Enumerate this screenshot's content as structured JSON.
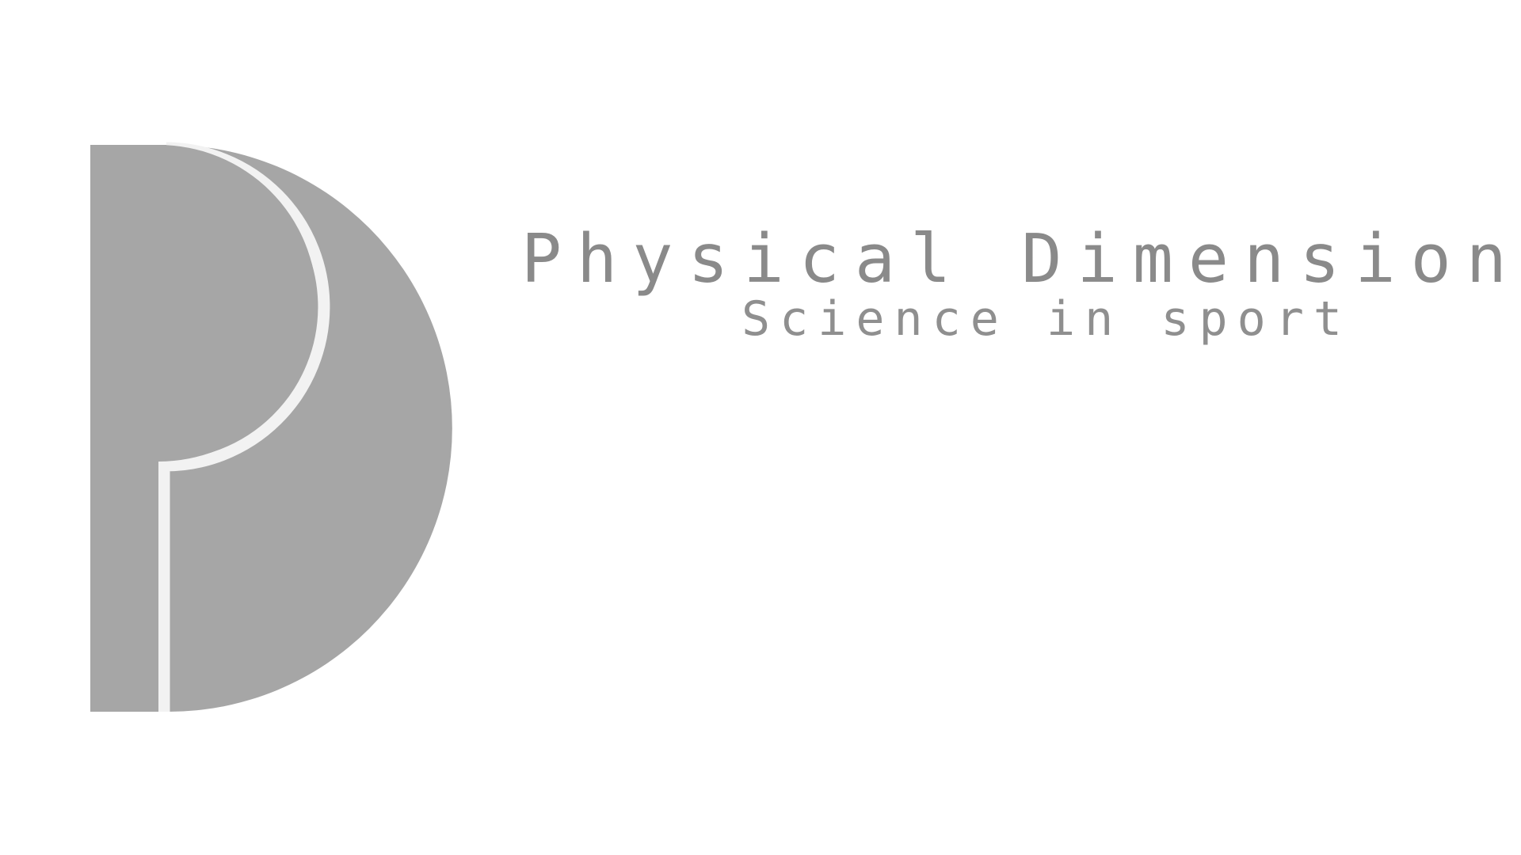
{
  "brand": {
    "name": "Physical Dimensions",
    "tagline": "Science in sport"
  },
  "colors": {
    "background": "#ffffff",
    "logo_fill": "#a6a6a6",
    "logo_stroke": "#f2f2f2",
    "text": "#8a8a8a"
  },
  "icons": {
    "logo": "pd-monogram-logo"
  }
}
